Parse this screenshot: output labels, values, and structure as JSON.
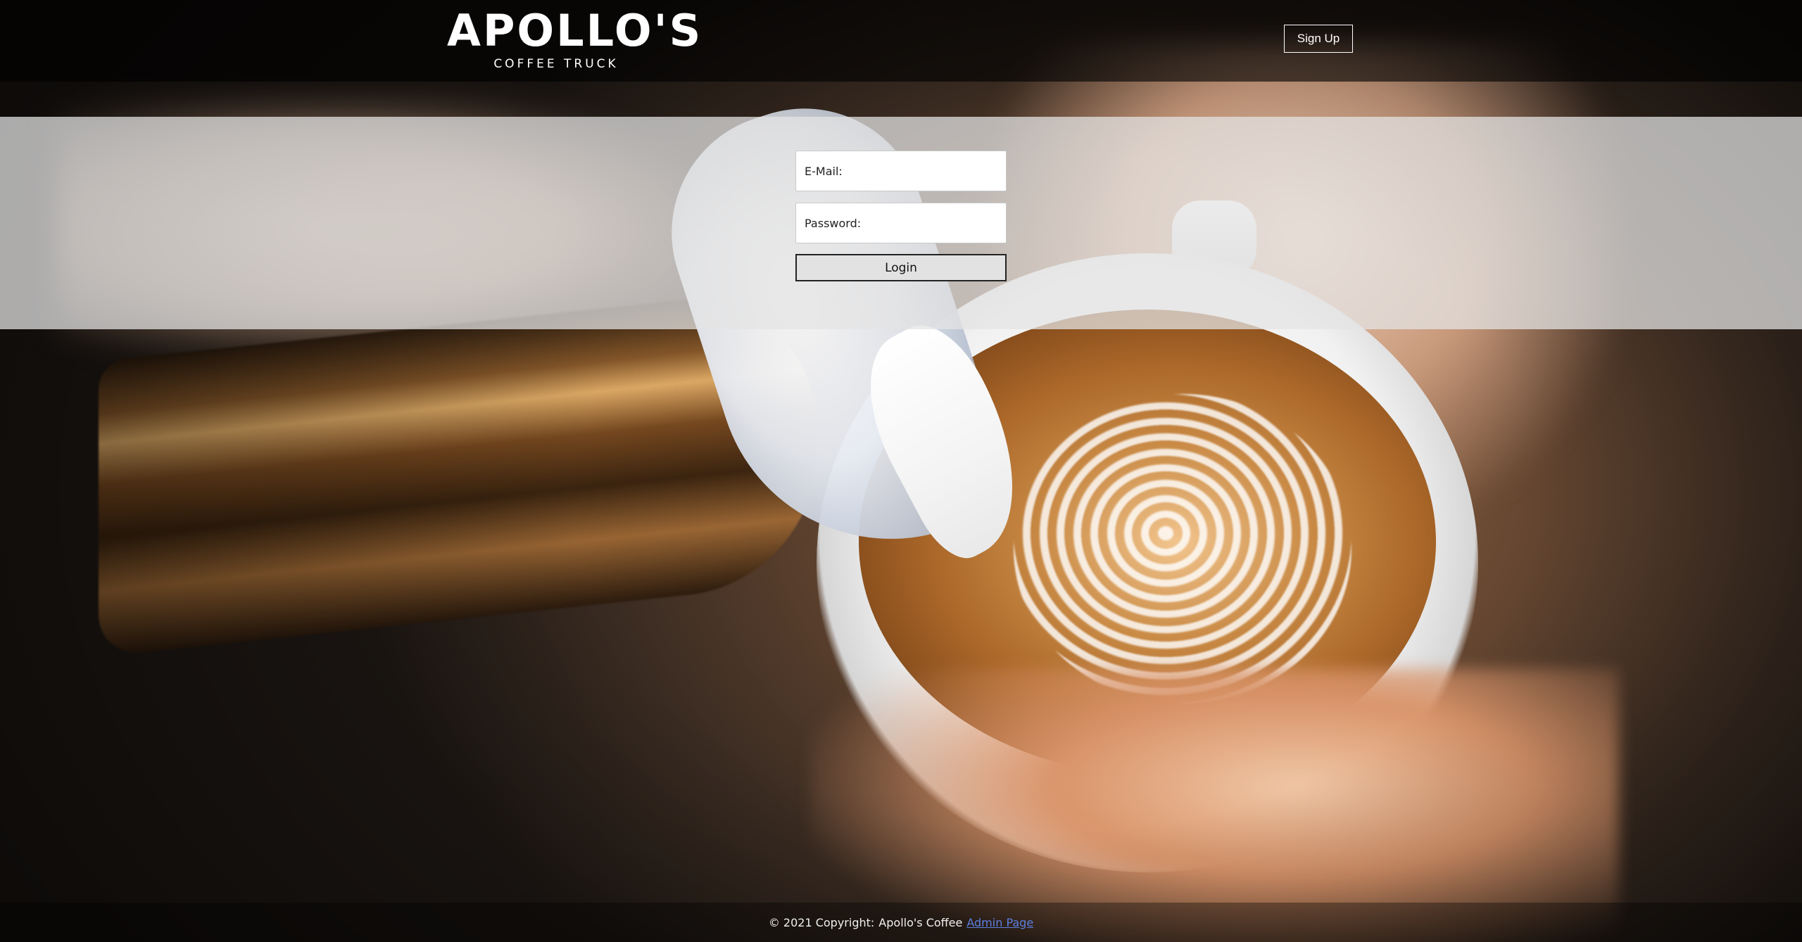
{
  "header": {
    "logo_main": "APOLLO'S",
    "logo_sub": "COFFEE TRUCK",
    "signup_label": "Sign Up"
  },
  "login": {
    "email_placeholder": "E-Mail:",
    "password_placeholder": "Password:",
    "login_label": "Login"
  },
  "footer": {
    "copyright": "© 2021 Copyright:",
    "brand": "Apollo's Coffee",
    "admin_link": "Admin Page"
  },
  "colors": {
    "header_bg": "#000000",
    "link": "#5d7fe0"
  },
  "background": {
    "image_desc": "coffee-latte-art-photo"
  }
}
